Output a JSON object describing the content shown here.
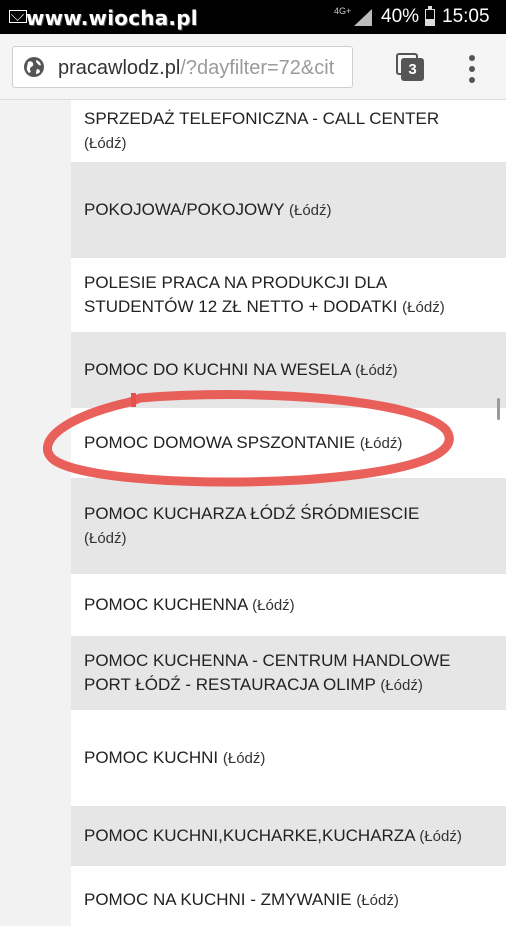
{
  "status_bar": {
    "watermark": "www.wiocha.pl",
    "network": "4G+",
    "battery": "40%",
    "time": "15:05"
  },
  "browser": {
    "url_host": "pracawlodz.pl",
    "url_path": "/?dayfilter=72&cit",
    "tab_count": "3"
  },
  "listings": [
    {
      "title": "SPRZEDAŻ TELEFONICZNA - CALL CENTER",
      "location": "(Łódź)"
    },
    {
      "title": "POKOJOWA/POKOJOWY",
      "location": "(Łódź)"
    },
    {
      "title": "POLESIE PRACA NA PRODUKCJI DLA STUDENTÓW 12 ZŁ NETTO + DODATKI",
      "location": "(Łódź)"
    },
    {
      "title": "POMOC DO KUCHNI NA WESELA",
      "location": "(Łódź)"
    },
    {
      "title": "POMOC DOMOWA SPSZONTANIE",
      "location": "(Łódź)"
    },
    {
      "title": "POMOC KUCHARZA ŁÓDŹ ŚRÓDMIESCIE",
      "location": "(Łódź)"
    },
    {
      "title": "POMOC KUCHENNA",
      "location": "(Łódź)"
    },
    {
      "title": "POMOC KUCHENNA - CENTRUM HANDLOWE PORT ŁÓDŹ - RESTAURACJA OLIMP",
      "location": "(Łódź)"
    },
    {
      "title": "POMOC KUCHNI",
      "location": "(Łódź)"
    },
    {
      "title": "POMOC KUCHNI,KUCHARKE,KUCHARZA",
      "location": "(Łódź)"
    },
    {
      "title": "POMOC NA KUCHNI - ZMYWANIE",
      "location": "(Łódź)"
    }
  ],
  "colors": {
    "highlight": "#e8504a",
    "row_grey": "#e6e6e6",
    "row_white": "#ffffff"
  }
}
